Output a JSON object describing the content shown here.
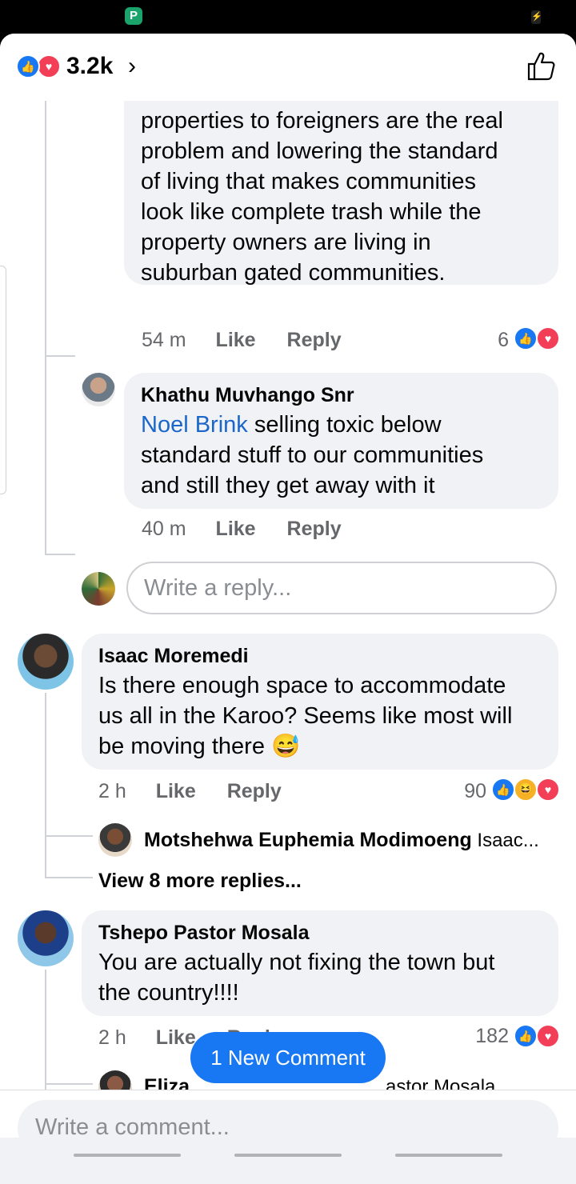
{
  "header": {
    "reaction_count": "3.2k",
    "chevron": "›",
    "reaction_icons": [
      "like-icon",
      "love-icon"
    ]
  },
  "comments": [
    {
      "text_lines": [
        "properties to foreigners are the real",
        "problem and lowering the standard",
        "of living that makes communities",
        "look like complete trash while the",
        "property owners are living in",
        "suburban gated communities."
      ],
      "time": "54 m",
      "like_label": "Like",
      "reply_label": "Reply",
      "reaction_count": "6",
      "reactions": [
        "like-icon",
        "love-icon"
      ]
    },
    {
      "author": "Khathu Muvhango Snr",
      "mention": "Noel Brink",
      "text_lines": [
        " selling toxic below",
        "standard stuff to our communities",
        "and still they get away with it"
      ],
      "time": "40 m",
      "like_label": "Like",
      "reply_label": "Reply"
    },
    {
      "author": "Isaac Moremedi",
      "text_lines": [
        "Is there enough space to accommodate",
        "us all in the Karoo? Seems like most will",
        "be moving there 😅"
      ],
      "time": "2 h",
      "like_label": "Like",
      "reply_label": "Reply",
      "reaction_count": "90",
      "reactions": [
        "like-icon",
        "haha-icon",
        "love-icon"
      ],
      "reply_preview": {
        "author": "Motshehwa Euphemia Modimoeng",
        "snippet": " Isaac..."
      },
      "view_more": "View 8 more replies..."
    },
    {
      "author": "Tshepo Pastor Mosala",
      "text_lines": [
        "You are actually not fixing the town but",
        "the country!!!!"
      ],
      "time": "2 h",
      "like_label": "Like",
      "reply_label": "Reply",
      "reaction_count": "182",
      "reactions": [
        "like-icon",
        "love-icon"
      ],
      "reply_preview": {
        "author": "Eliza",
        "snippet": "astor Mosala ..."
      }
    }
  ],
  "reply_box": {
    "placeholder": "Write a reply..."
  },
  "new_comment_banner": "1 New Comment",
  "composer": {
    "placeholder": "Write a comment..."
  },
  "colors": {
    "accent": "#1877f2",
    "love": "#f33e58",
    "bubble": "#f0f2f5",
    "mention": "#1b66c9"
  }
}
